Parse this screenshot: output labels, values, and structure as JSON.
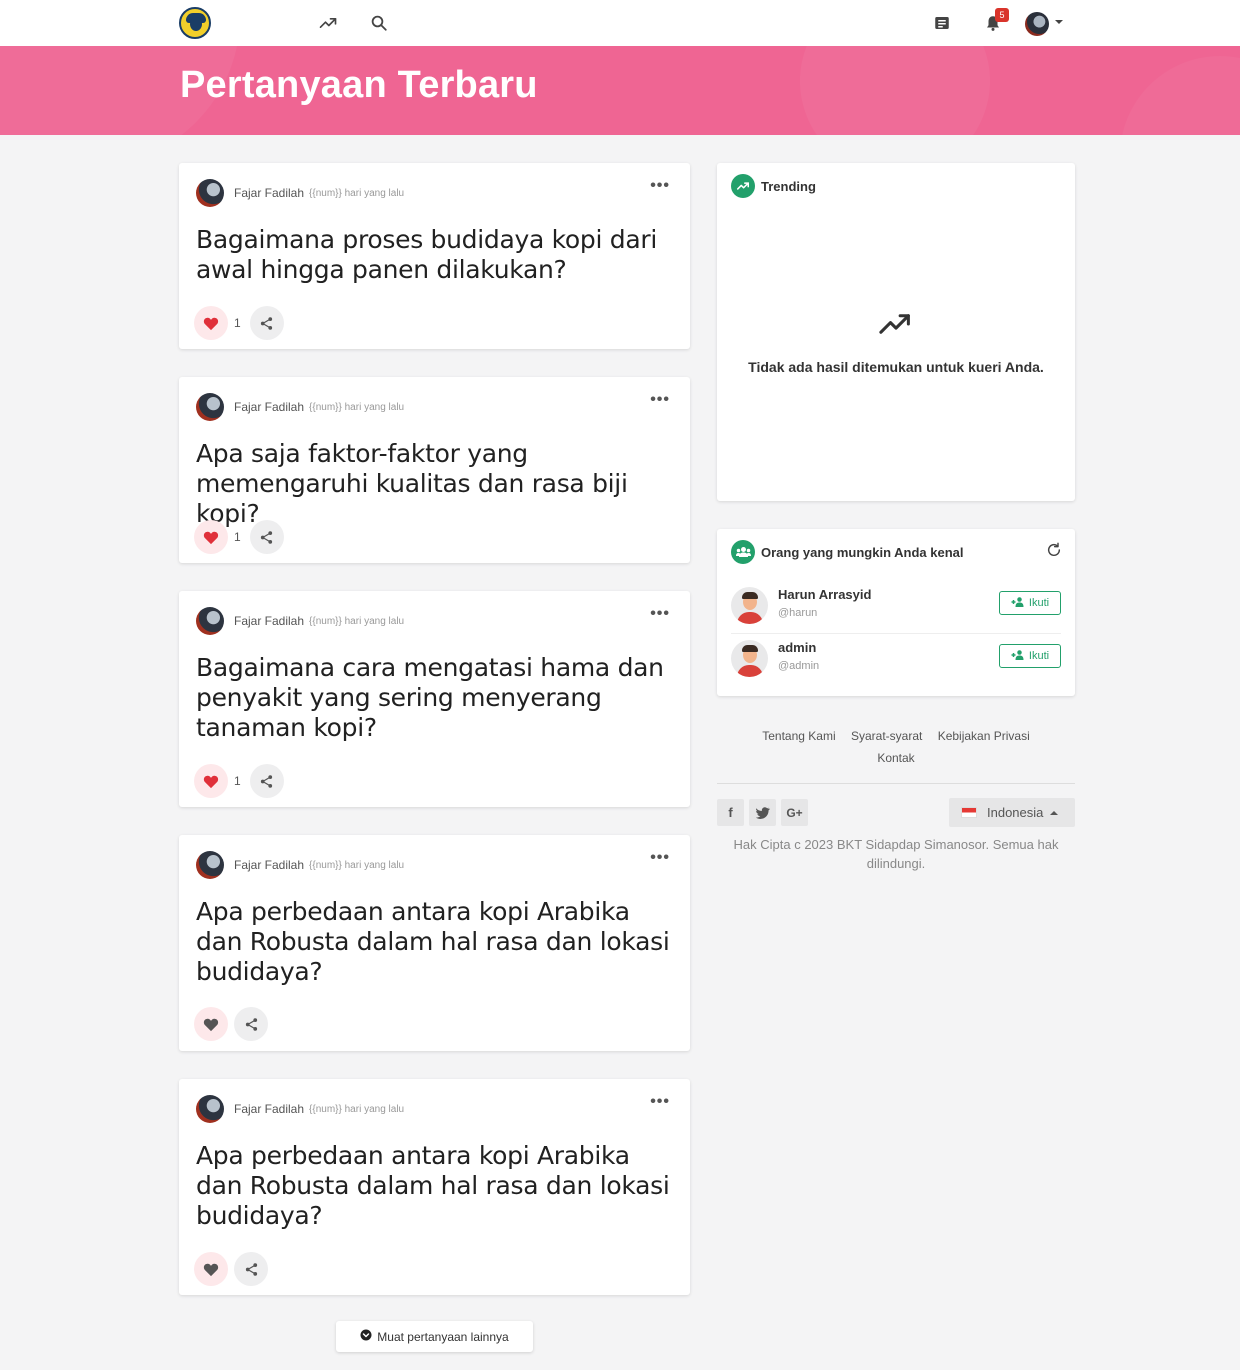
{
  "nav": {
    "notification_count": "5"
  },
  "hero": {
    "title": "Pertanyaan Terbaru"
  },
  "questions": [
    {
      "author": "Fajar Fadilah",
      "time": "{{num}} hari yang lalu",
      "title": "Bagaimana proses budidaya kopi dari awal hingga panen dilakukan?",
      "likes": "1",
      "liked": true
    },
    {
      "author": "Fajar Fadilah",
      "time": "{{num}} hari yang lalu",
      "title": "Apa saja faktor-faktor yang memengaruhi kualitas dan rasa biji kopi?",
      "likes": "1",
      "liked": true
    },
    {
      "author": "Fajar Fadilah",
      "time": "{{num}} hari yang lalu",
      "title": "Bagaimana cara mengatasi hama dan penyakit yang sering menyerang tanaman kopi?",
      "likes": "1",
      "liked": true
    },
    {
      "author": "Fajar Fadilah",
      "time": "{{num}} hari yang lalu",
      "title": "Apa perbedaan antara kopi Arabika dan Robusta dalam hal rasa dan lokasi budidaya?",
      "likes": "",
      "liked": false
    },
    {
      "author": "Fajar Fadilah",
      "time": "{{num}} hari yang lalu",
      "title": "Apa perbedaan antara kopi Arabika dan Robusta dalam hal rasa dan lokasi budidaya?",
      "likes": "",
      "liked": false
    }
  ],
  "load_more": {
    "label": "Muat pertanyaan lainnya"
  },
  "trending": {
    "title": "Trending",
    "empty_text": "Tidak ada hasil ditemukan untuk kueri Anda."
  },
  "suggestions": {
    "title": "Orang yang mungkin Anda kenal",
    "people": [
      {
        "name": "Harun Arrasyid",
        "handle": "@harun",
        "follow_label": "Ikuti"
      },
      {
        "name": "admin",
        "handle": "@admin",
        "follow_label": "Ikuti"
      }
    ]
  },
  "footer": {
    "links": [
      "Tentang Kami",
      "Syarat-syarat",
      "Kebijakan Privasi",
      "Kontak"
    ],
    "language": "Indonesia",
    "copyright": "Hak Cipta c 2023 BKT Sidapdap Simanosor. Semua hak dilindungi."
  },
  "colors": {
    "accent_pink": "#ef6593",
    "green": "#22a06b",
    "like_red": "#e0303a",
    "badge_red": "#d9342b"
  }
}
